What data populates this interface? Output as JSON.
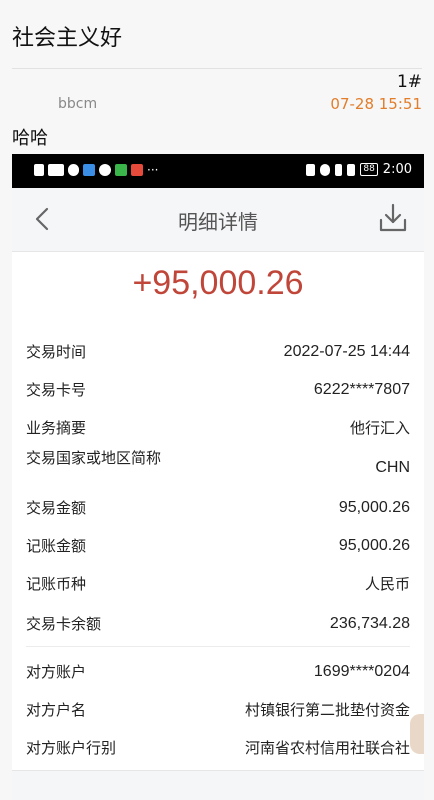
{
  "forum": {
    "title": "社会主义好",
    "floor": "1#",
    "username": "bbcm",
    "time": "07-28 15:51",
    "body": "哈哈"
  },
  "phone": {
    "status_time": "2:00",
    "battery": "88",
    "overflow_dots": "···",
    "page_title": "明细详情",
    "amount": "+95,000.26",
    "details": [
      {
        "label": "交易时间",
        "value": "2022-07-25 14:44"
      },
      {
        "label": "交易卡号",
        "value": "6222****7807"
      },
      {
        "label": "业务摘要",
        "value": "他行汇入"
      },
      {
        "label": "交易国家或地区简称",
        "value": "CHN"
      },
      {
        "label": "交易金额",
        "value": "95,000.26"
      },
      {
        "label": "记账金额",
        "value": "95,000.26"
      },
      {
        "label": "记账币种",
        "value": "人民币"
      },
      {
        "label": "交易卡余额",
        "value": "236,734.28"
      }
    ],
    "counterparty": [
      {
        "label": "对方账户",
        "value": "1699****0204"
      },
      {
        "label": "对方户名",
        "value": "村镇银行第二批垫付资金"
      },
      {
        "label": "对方账户行别",
        "value": "河南省农村信用社联合社"
      }
    ],
    "accent_color": "#c0463a"
  }
}
